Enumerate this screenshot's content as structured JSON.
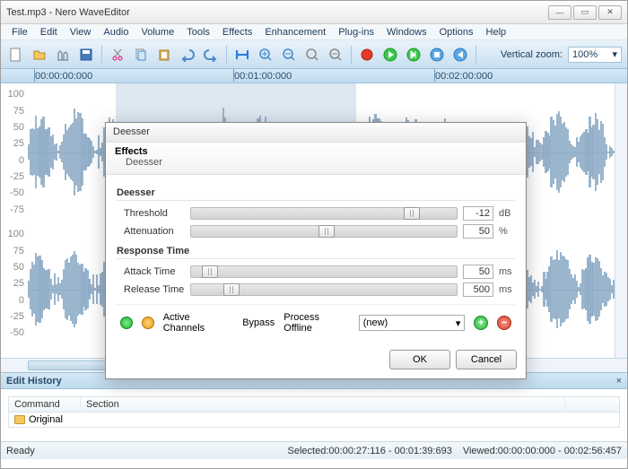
{
  "window": {
    "title": "Test.mp3 - Nero WaveEditor"
  },
  "menu": [
    "File",
    "Edit",
    "View",
    "Audio",
    "Volume",
    "Tools",
    "Effects",
    "Enhancement",
    "Plug-ins",
    "Windows",
    "Options",
    "Help"
  ],
  "toolbar": {
    "zoom_label": "Vertical zoom:",
    "zoom_value": "100%"
  },
  "timeline": {
    "ticks": [
      "00:00:00:000",
      "00:01:00:000",
      "00:02:00:000"
    ]
  },
  "yaxis_top": [
    "100",
    "75",
    "50",
    "25",
    "0",
    "-25",
    "-50",
    "-75"
  ],
  "yaxis_bot": [
    "100",
    "75",
    "50",
    "25",
    "0",
    "-25",
    "-50"
  ],
  "history": {
    "title": "Edit History",
    "cols": [
      "Command",
      "Section"
    ],
    "rows": [
      {
        "cmd": "Original",
        "sec": ""
      }
    ]
  },
  "status": {
    "left": "Ready",
    "sel_label": "Selected:",
    "sel_value": "00:00:27:116 - 00:01:39:693",
    "view_label": "Viewed:",
    "view_value": "00:00:00:000 - 00:02:56:457"
  },
  "dialog": {
    "title": "Deesser",
    "effects_head": "Effects",
    "effects_path": "Deesser",
    "sect1": "Deesser",
    "sect2": "Response Time",
    "params": {
      "threshold": {
        "label": "Threshold",
        "value": "-12",
        "unit": "dB",
        "pos": 80
      },
      "attenuation": {
        "label": "Attenuation",
        "value": "50",
        "unit": "%",
        "pos": 48
      },
      "attack": {
        "label": "Attack Time",
        "value": "50",
        "unit": "ms",
        "pos": 4
      },
      "release": {
        "label": "Release Time",
        "value": "500",
        "unit": "ms",
        "pos": 12
      }
    },
    "strip": {
      "active": "Active Channels",
      "bypass": "Bypass",
      "offline": "Process Offline",
      "preset": "(new)"
    },
    "btns": {
      "ok": "OK",
      "cancel": "Cancel"
    }
  }
}
